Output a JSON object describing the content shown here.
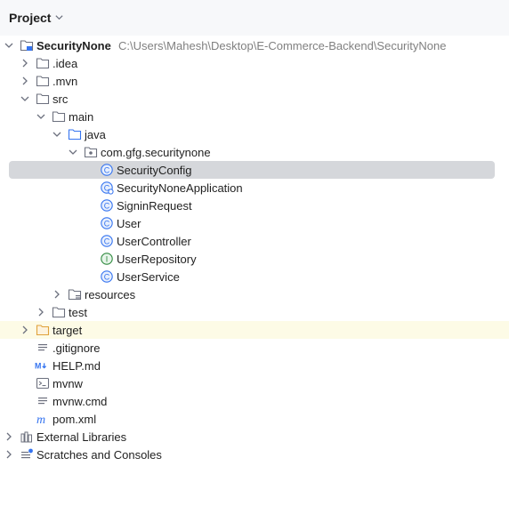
{
  "panel": {
    "title": "Project"
  },
  "tree": {
    "root": {
      "label": "SecurityNone",
      "path": "C:\\Users\\Mahesh\\Desktop\\E-Commerce-Backend\\SecurityNone"
    },
    "idea": ".idea",
    "mvn": ".mvn",
    "src": "src",
    "main": "main",
    "java": "java",
    "package": "com.gfg.securitynone",
    "classes": [
      "SecurityConfig",
      "SecurityNoneApplication",
      "SigninRequest",
      "User",
      "UserController",
      "UserRepository",
      "UserService"
    ],
    "resources": "resources",
    "test": "test",
    "target": "target",
    "files": [
      ".gitignore",
      "HELP.md",
      "mvnw",
      "mvnw.cmd",
      "pom.xml"
    ],
    "external": "External Libraries",
    "scratches": "Scratches and Consoles"
  },
  "colors": {
    "selection": "#d5d7db",
    "excluded_row": "#fdfbe6",
    "class_icon": "#3574f0",
    "interface_icon": "#2f8a3e",
    "folder": "#6c707e",
    "excluded_folder": "#e0a23b"
  }
}
